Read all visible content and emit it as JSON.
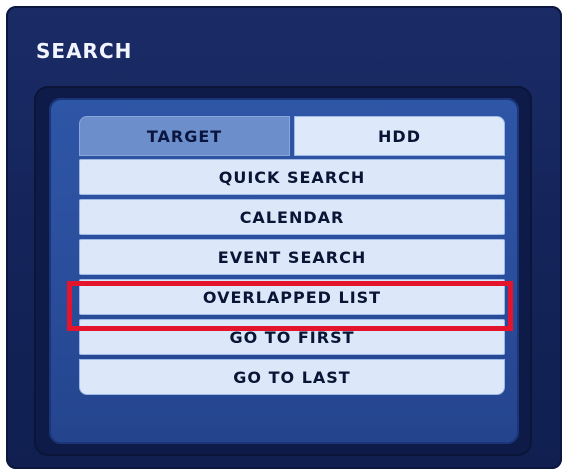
{
  "window": {
    "title": "SEARCH"
  },
  "tabs": [
    {
      "label": "TARGET",
      "active": true
    },
    {
      "label": "HDD",
      "active": false
    }
  ],
  "menu": {
    "items": [
      {
        "label": "QUICK SEARCH"
      },
      {
        "label": "CALENDAR"
      },
      {
        "label": "EVENT SEARCH"
      },
      {
        "label": "OVERLAPPED LIST",
        "highlighted": true
      },
      {
        "label": "GO TO FIRST"
      },
      {
        "label": "GO TO LAST"
      }
    ]
  },
  "colors": {
    "window_bg": "#14245a",
    "panel_bg": "#2a4d9b",
    "item_bg": "#dce8fa",
    "active_tab": "#6c8fcc",
    "highlight": "#e3142b"
  }
}
